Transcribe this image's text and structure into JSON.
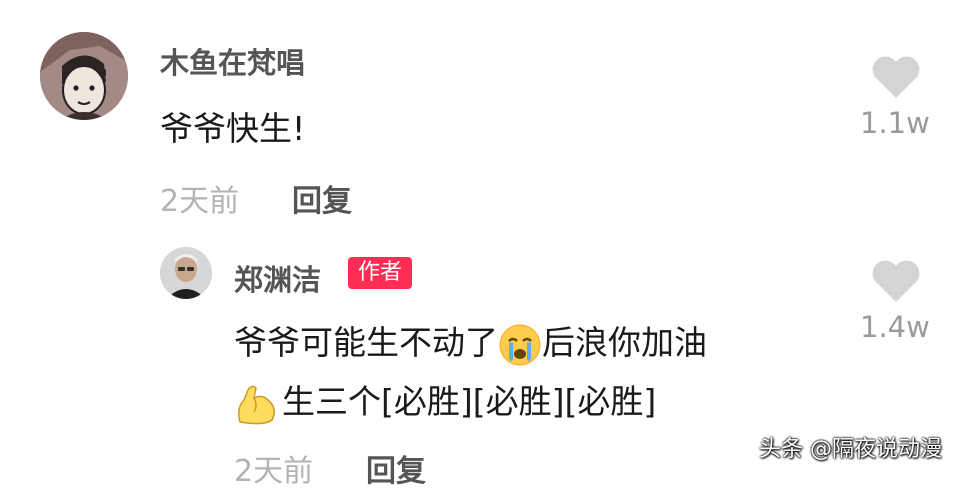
{
  "comment": {
    "username": "木鱼在梵唱",
    "text": "爷爷快生!",
    "time": "2天前",
    "reply_label": "回复",
    "likes": "1.1w",
    "avatar_icon": "avatar-illustrated-face"
  },
  "reply": {
    "username": "郑渊洁",
    "badge": "作者",
    "line1_before": "爷爷可能生不动了",
    "line1_emoji": "crying-face",
    "line1_after": "后浪你加油",
    "line2_emoji": "flexed-biceps",
    "line2_text": "生三个[必胜][必胜][必胜]",
    "time": "2天前",
    "reply_label": "回复",
    "likes": "1.4w",
    "avatar_icon": "avatar-photo"
  },
  "watermark": "头条 @隔夜说动漫",
  "colors": {
    "badge": "#ff2d55",
    "username": "#555555",
    "meta": "#b3b3b3",
    "heart": "#d4d4d4"
  }
}
